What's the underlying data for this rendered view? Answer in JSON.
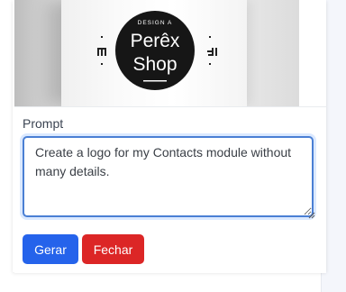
{
  "preview": {
    "logo_top_text": "DESIGN A",
    "logo_line1": "Perêx",
    "logo_line2": "Shop",
    "image_description_icon": "tshirt-mockup-logo"
  },
  "prompt": {
    "label": "Prompt",
    "value": "Create a logo for my Contacts module without many details."
  },
  "buttons": {
    "generate_label": "Gerar",
    "close_label": "Fechar"
  },
  "colors": {
    "primary": "#2563eb",
    "danger": "#dc2626",
    "focus_border": "#4a7fd4"
  }
}
